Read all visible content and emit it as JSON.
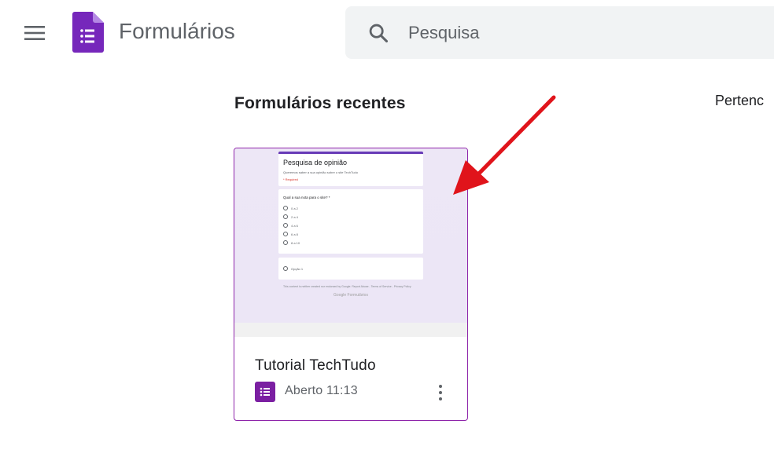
{
  "header": {
    "app_title": "Formulários",
    "menu_icon": "hamburger-menu-icon",
    "logo_icon": "google-forms-logo",
    "search": {
      "placeholder": "Pesquisa",
      "icon": "search-icon"
    }
  },
  "main": {
    "section_title": "Formulários recentes",
    "owner_filter_label": "Pertenc",
    "recent_forms": [
      {
        "title": "Tutorial TechTudo",
        "meta": "Aberto 11:13",
        "type_icon": "forms-list-icon",
        "preview": {
          "form_title": "Pesquisa de opinião",
          "description": "Queremos saber a sua opinião sobre o site TechTudo",
          "required_note": "* Required",
          "question": "Qual a sua nota para o site? *",
          "options": [
            "0 a 2",
            "2 a 4",
            "4 a 6",
            "6 a 8",
            "8 a 10"
          ],
          "section_option": "Opção 1",
          "footer": "This content is neither created nor endorsed by Google. Report Abuse - Terms of Service - Privacy Policy",
          "brand": "Google Formulários"
        }
      }
    ]
  },
  "colors": {
    "accent_purple": "#7b1fa2",
    "card_border": "#8e24aa",
    "thumb_bg": "#ede7f6",
    "annotation_arrow": "#e0141b"
  }
}
